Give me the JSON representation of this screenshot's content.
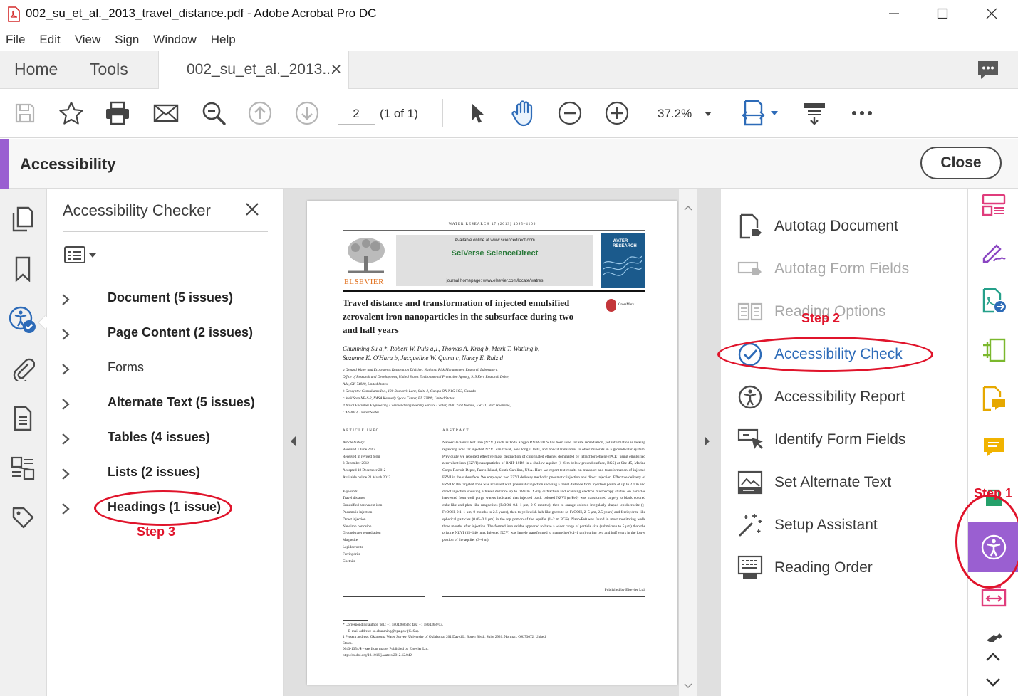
{
  "window": {
    "title": "002_su_et_al._2013_travel_distance.pdf - Adobe Acrobat Pro DC"
  },
  "menu": [
    "File",
    "Edit",
    "View",
    "Sign",
    "Window",
    "Help"
  ],
  "tabs": {
    "home": "Home",
    "tools": "Tools",
    "document": "002_su_et_al._2013..."
  },
  "toolbar": {
    "page_number": "2",
    "page_count": "(1 of 1)",
    "zoom": "37.2%"
  },
  "accessibility_bar": {
    "title": "Accessibility",
    "close_label": "Close"
  },
  "checker": {
    "title": "Accessibility Checker",
    "items": [
      {
        "label": "Document (5 issues)",
        "bold": true
      },
      {
        "label": "Page Content (2 issues)",
        "bold": true
      },
      {
        "label": "Forms",
        "bold": false
      },
      {
        "label": "Alternate Text (5 issues)",
        "bold": true
      },
      {
        "label": "Tables (4 issues)",
        "bold": true
      },
      {
        "label": "Lists (2 issues)",
        "bold": true
      },
      {
        "label": "Headings (1 issue)",
        "bold": true
      }
    ]
  },
  "tools_panel": {
    "items": [
      {
        "label": "Autotag Document",
        "icon": "autotag-document-icon",
        "enabled": true
      },
      {
        "label": "Autotag Form Fields",
        "icon": "autotag-form-fields-icon",
        "enabled": false
      },
      {
        "label": "Reading Options",
        "icon": "reading-options-icon",
        "enabled": false
      },
      {
        "label": "Accessibility Check",
        "icon": "accessibility-check-icon",
        "enabled": true,
        "highlight": true
      },
      {
        "label": "Accessibility Report",
        "icon": "accessibility-report-icon",
        "enabled": true
      },
      {
        "label": "Identify Form Fields",
        "icon": "identify-form-fields-icon",
        "enabled": true
      },
      {
        "label": "Set Alternate Text",
        "icon": "set-alternate-text-icon",
        "enabled": true
      },
      {
        "label": "Setup Assistant",
        "icon": "setup-assistant-icon",
        "enabled": true
      },
      {
        "label": "Reading Order",
        "icon": "reading-order-icon",
        "enabled": true
      }
    ]
  },
  "annotations": {
    "step1": "Step 1",
    "step2": "Step 2",
    "step3": "Step 3"
  },
  "pdf_page": {
    "journal_line": "WATER RESEARCH 47 (2013) 4095–4106",
    "available_online": "Available online at www.sciencedirect.com",
    "sciverse": "SciVerse ScienceDirect",
    "journal_homepage": "journal homepage: www.elsevier.com/locate/watres",
    "publisher": "ELSEVIER",
    "cover_title": "WATER RESEARCH",
    "crossmark": "CrossMark",
    "article_title": "Travel distance and transformation of injected emulsified zerovalent iron nanoparticles in the subsurface during two and half years",
    "authors_line1": "Chunming Su a,*, Robert W. Puls a,1, Thomas A. Krug b, Mark T. Watling b,",
    "authors_line2": "Suzanne K. O'Hara b, Jacqueline W. Quinn c, Nancy E. Ruiz d",
    "affiliations": [
      "a Ground Water and Ecosystems Restoration Division, National Risk Management Research Laboratory,",
      "Office of Research and Development, United States Environmental Protection Agency, 919 Kerr Research Drive,",
      "Ada, OK 74820, United States",
      "b Geosyntec Consultants Inc., 130 Research Lane, Suite 2, Guelph ON N1G 5G3, Canada",
      "c Mail Stop NE-S-2, NASA Kennedy Space Center, FL 32899, United States",
      "d Naval Facilities Engineering Command Engineering Service Center, 1100 23rd Avenue, ESC31, Port Hueneme,",
      "CA 93043, United States"
    ],
    "article_info_heading": "ARTICLE INFO",
    "abstract_heading": "ABSTRACT",
    "article_info": [
      "Article history:",
      "Received 1 June 2012",
      "Received in revised form",
      "3 December 2012",
      "Accepted 18 December 2012",
      "Available online 21 March 2013",
      "",
      "Keywords:",
      "Travel distance",
      "Emulsified zerovalent iron",
      "Pneumatic injection",
      "Direct injection",
      "Nanoiron corrosion",
      "Groundwater remediation",
      "Magnetite",
      "Lepidocrocite",
      "Ferrihydrite",
      "Goethite"
    ],
    "abstract": "Nanoscale zerovalent iron (NZVI) such as Toda Kogyo RNIP-10DS has been used for site remediation, yet information is lacking regarding how far injected NZVI can travel, how long it lasts, and how it transforms to other minerals in a groundwater system. Previously we reported effective mass destruction of chlorinated ethenes dominated by tetrachloroethene (PCE) using emulsified zerovalent iron (EZVI) nanoparticles of RNIP-10DS in a shallow aquifer (1–6 m below ground surface, BGS) at Site 45, Marine Corps Recruit Depot, Parris Island, South Carolina, USA. Here we report test results on transport and transformation of injected EZVI in the subsurface. We employed two EZVI delivery methods: pneumatic injection and direct injection. Effective delivery of EZVI to the targeted zone was achieved with pneumatic injection showing a travel distance from injection points of up to 2.1 m and direct injection showing a travel distance up to 0.89 m. X-ray diffraction and scanning electron microscopy studies on particles harvested from well purge waters indicated that injected black colored NZVI (α-Fe0) was transformed largely to black colored cube-like and plate-like magnetites (Fe3O4, 0.1–1 μm, 0–9 months), then to orange colored irregularly shaped lepidocrocite (γ-FeOOH, 0.1–1 μm, 9 months to 2.5 years), then to yellowish lath-like goethite (α-FeOOH, 2–5 μm, 2.5 years) and ferrihydrite-like spherical particles (0.05–0.1 μm) in the top portion of the aquifer (1–2 m BGS). Nano-Fe0 was found in most monitoring wells three months after injection. The formed iron oxides appeared to have a wider range of particle size (submicron to 5 μm) than the pristine NZVI (35–140 nm). Injected NZVI was largely transformed to magnetite (0.1–1 μm) during two and half years in the lower portion of the aquifer (3–6 m).",
    "published_by": "Published by Elsevier Ltd.",
    "footnotes": [
      "* Corresponding author. Tel.: +1 5804368638; fax: +1 5804368703.",
      "E-mail address: su.chunming@epa.gov (C. Su).",
      "1 Present address: Oklahoma Water Survey, University of Oklahoma, 201 David L. Boren Blvd., Suite 2920, Norman, OK 73072, United",
      "States.",
      "0043-1354/$ – see front matter Published by Elsevier Ltd.",
      "http://dx.doi.org/10.1016/j.watres.2012.12.042"
    ]
  },
  "colors": {
    "accent_purple": "#9a5fd1",
    "link_blue": "#2d6bb8",
    "annotation_red": "#e0142b"
  }
}
